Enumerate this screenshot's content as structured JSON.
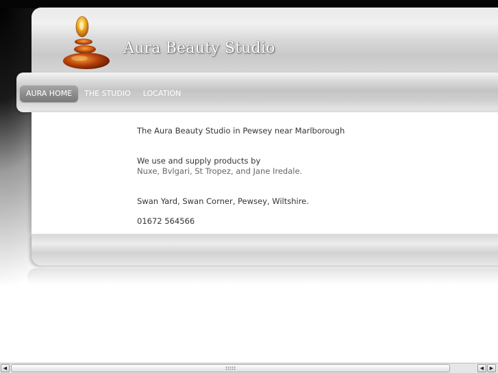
{
  "site": {
    "title": "Aura Beauty Studio"
  },
  "nav": {
    "items": [
      {
        "label": "AURA HOME",
        "active": true
      },
      {
        "label": "THE STUDIO",
        "active": false
      },
      {
        "label": "LOCATION",
        "active": false
      }
    ]
  },
  "content": {
    "intro": "The Aura Beauty Studio in Pewsey near Marlborough",
    "products_lead": "We use and supply products by",
    "brands": "Nuxe, Bvlgari, St Tropez, and Jane Iredale.",
    "address": "Swan Yard, Swan Corner, Pewsey, Wiltshire.",
    "phone": "01672 564566"
  },
  "icons": {
    "logo": "stacked-amber-stones-logo",
    "scroll_left": "arrow-left-icon",
    "scroll_right": "arrow-right-icon"
  },
  "colors": {
    "logo_amber": "#e07a10",
    "logo_dark": "#7a1a08",
    "text": "#333333",
    "brands_text": "#666666",
    "nav_active": "#8c8c8c"
  }
}
